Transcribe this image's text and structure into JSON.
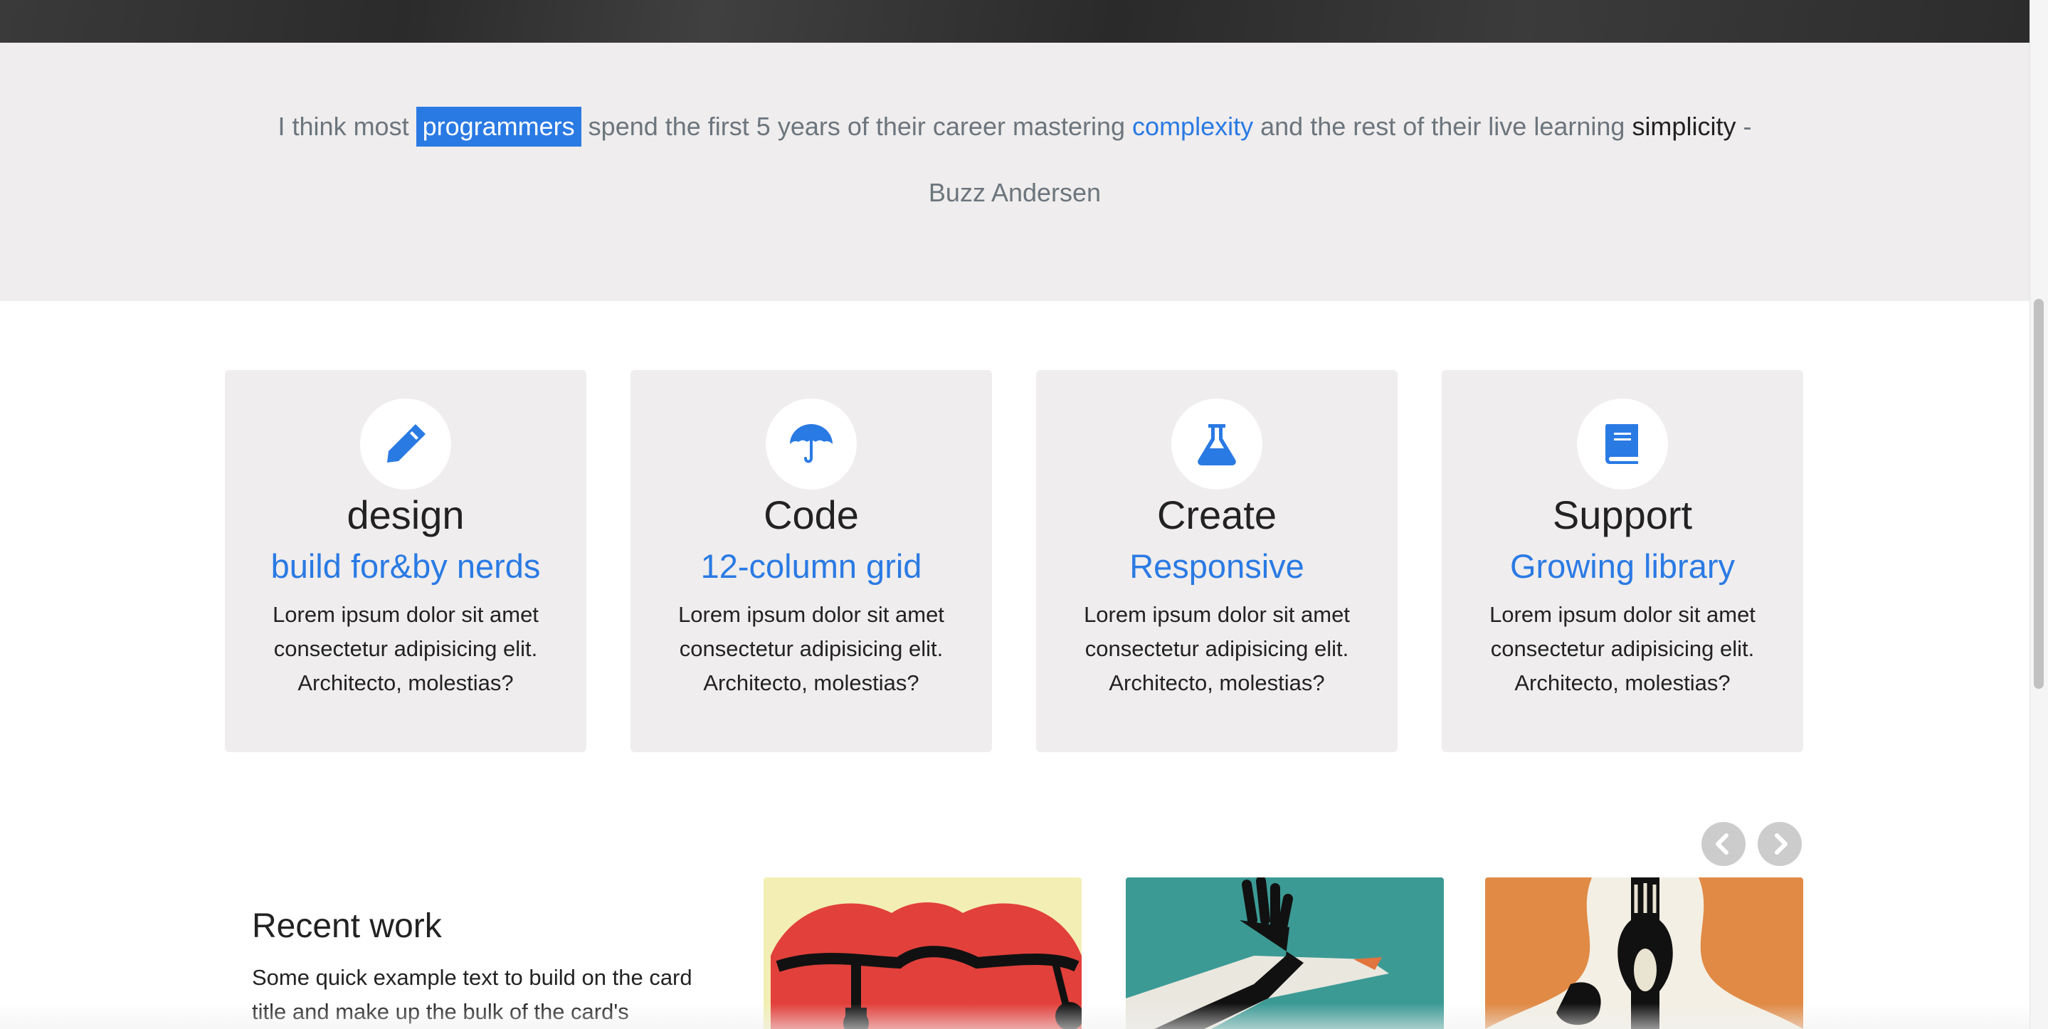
{
  "quote": {
    "parts": {
      "p1": "I think most",
      "highlight": "programmers",
      "p2": "spend the first 5 years of their career mastering",
      "blue": "complexity",
      "p3": "and the rest of their live learning",
      "dark": "simplicity",
      "dash": "-"
    },
    "author": "Buzz Andersen"
  },
  "features": [
    {
      "icon": "pencil-icon",
      "title": "design",
      "subtitle": "build for&by nerds",
      "body": "Lorem ipsum dolor sit amet consectetur adipisicing elit. Architecto, molestias?"
    },
    {
      "icon": "umbrella-icon",
      "title": "Code",
      "subtitle": "12-column grid",
      "body": "Lorem ipsum dolor sit amet consectetur adipisicing elit. Architecto, molestias?"
    },
    {
      "icon": "flask-icon",
      "title": "Create",
      "subtitle": "Responsive",
      "body": "Lorem ipsum dolor sit amet consectetur adipisicing elit. Architecto, molestias?"
    },
    {
      "icon": "book-icon",
      "title": "Support",
      "subtitle": "Growing library",
      "body": "Lorem ipsum dolor sit amet consectetur adipisicing elit. Architecto, molestias?"
    }
  ],
  "recent": {
    "title": "Recent work",
    "text": "Some quick example text to build on the card title and make up the bulk of the card's"
  },
  "carousel": {
    "prev_icon": "chevron-left-icon",
    "next_icon": "chevron-right-icon"
  },
  "colors": {
    "accent": "#2a7ae4",
    "band": "#efeded",
    "topbar": "#333333"
  }
}
